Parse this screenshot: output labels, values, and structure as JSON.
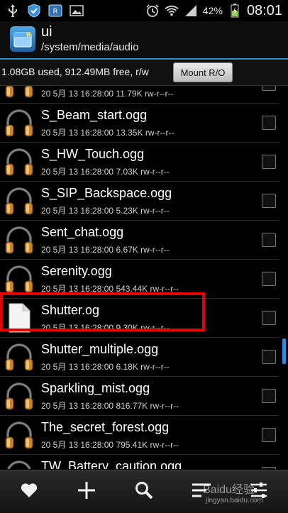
{
  "status_bar": {
    "battery_percent": "42%",
    "time": "08:01"
  },
  "header": {
    "title": "ui",
    "path": "/system/media/audio"
  },
  "info_bar": {
    "text": "1.08GB used, 912.49MB free, r/w",
    "mount_button": "Mount R/O"
  },
  "files": [
    {
      "name": "",
      "date": "20 5月 13 16:28:00",
      "size": "11.79K",
      "perms": "rw-r--r--",
      "icon": "headphones-icon"
    },
    {
      "name": "S_Beam_start.ogg",
      "date": "20 5月 13 16:28:00",
      "size": "13.35K",
      "perms": "rw-r--r--",
      "icon": "headphones-icon"
    },
    {
      "name": "S_HW_Touch.ogg",
      "date": "20 5月 13 16:28:00",
      "size": "7.03K",
      "perms": "rw-r--r--",
      "icon": "headphones-icon"
    },
    {
      "name": "S_SIP_Backspace.ogg",
      "date": "20 5月 13 16:28:00",
      "size": "5.23K",
      "perms": "rw-r--r--",
      "icon": "headphones-icon"
    },
    {
      "name": "Sent_chat.ogg",
      "date": "20 5月 13 16:28:00",
      "size": "6.67K",
      "perms": "rw-r--r--",
      "icon": "headphones-icon"
    },
    {
      "name": "Serenity.ogg",
      "date": "20 5月 13 16:28:00",
      "size": "543.44K",
      "perms": "rw-r--r--",
      "icon": "headphones-icon"
    },
    {
      "name": "Shutter.og",
      "date": "20 5月 13 16:28:00",
      "size": "9.30K",
      "perms": "rw-r--r--",
      "icon": "document-icon"
    },
    {
      "name": "Shutter_multiple.ogg",
      "date": "20 5月 13 16:28:00",
      "size": "6.18K",
      "perms": "rw-r--r--",
      "icon": "headphones-icon"
    },
    {
      "name": "Sparkling_mist.ogg",
      "date": "20 5月 13 16:28:00",
      "size": "816.77K",
      "perms": "rw-r--r--",
      "icon": "headphones-icon"
    },
    {
      "name": "The_secret_forest.ogg",
      "date": "20 5月 13 16:28:00",
      "size": "795.41K",
      "perms": "rw-r--r--",
      "icon": "headphones-icon"
    },
    {
      "name": "TW_Battery_caution.ogg",
      "date": "",
      "size": "",
      "perms": "",
      "icon": "headphones-icon"
    }
  ],
  "bottom_bar": {
    "icons": [
      "heart-icon",
      "plus-icon",
      "search-icon",
      "sort-icon",
      "settings-icon"
    ]
  },
  "watermark": {
    "text": "Baidu经验",
    "sub": "jingyan.baidu.com"
  },
  "colors": {
    "accent": "#2b8fd6",
    "highlight": "#e60000"
  }
}
